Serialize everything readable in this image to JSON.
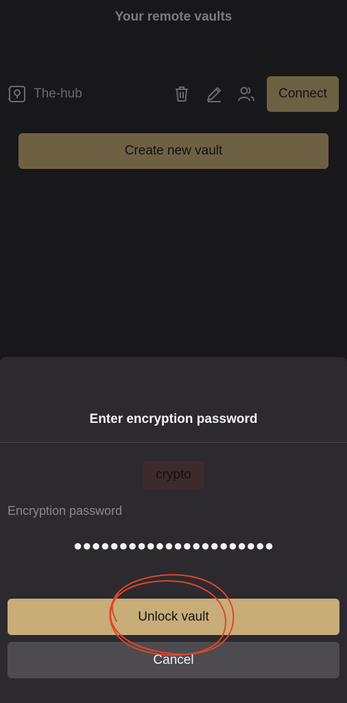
{
  "header": {
    "title": "Your remote vaults"
  },
  "vaults": [
    {
      "name": "The-hub",
      "connect_label": "Connect",
      "icons": [
        "vault-icon",
        "trash-icon",
        "pencil-icon",
        "users-icon"
      ]
    }
  ],
  "create_label": "Create new vault",
  "dialog": {
    "title": "Enter encryption password",
    "vault_chip": "crypto",
    "password_label": "Encryption password",
    "password_value": "●●●●●●●●●●●●●●●●●●●●●●",
    "unlock_label": "Unlock vault",
    "cancel_label": "Cancel"
  },
  "colors": {
    "background": "#18171a",
    "sheet": "#2c2a2e",
    "accent": "#c8ad78",
    "accent_dimmed": "#6e6143",
    "annotation": "#e0452a"
  }
}
